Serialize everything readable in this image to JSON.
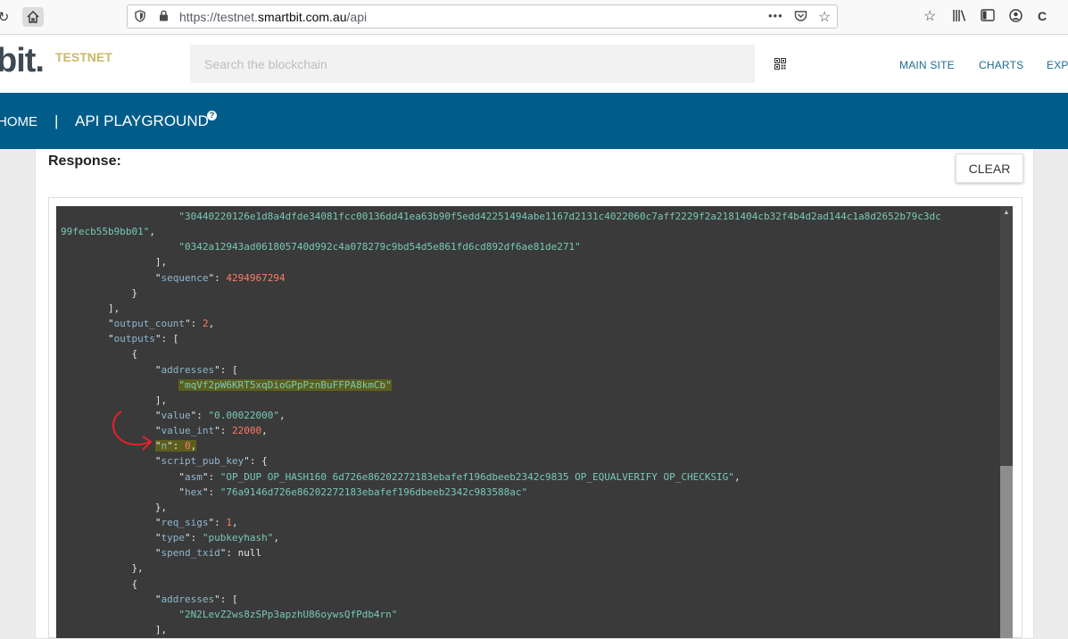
{
  "browser": {
    "url_prefix": "https://testnet.",
    "url_domain": "smartbit.com.au",
    "url_path": "/api",
    "more_glyph": "•••"
  },
  "site": {
    "logo_text": "bit.",
    "badge": "TESTNET",
    "search_placeholder": "Search the blockchain",
    "nav": [
      "MAIN SITE",
      "CHARTS",
      "EXPL"
    ]
  },
  "band": {
    "home": "HOME",
    "separator": "|",
    "page": "API PLAYGROUND",
    "help": "?"
  },
  "content": {
    "response_label": "Response:",
    "clear_button": "CLEAR"
  },
  "code_lines": [
    {
      "indent": 20,
      "parts": [
        [
          "s",
          "\"30440220126e1d8a4dfde34081fcc00136dd41ea63b90f5edd42251494abe1167d2131c4022060c7aff2229f2a2181404cb32f4b4d2ad144c1a8d2652b79c3dc"
        ]
      ]
    },
    {
      "indent": 0,
      "parts": [
        [
          "s",
          "99fecb55b9bb01\""
        ],
        [
          "p",
          ","
        ]
      ]
    },
    {
      "indent": 20,
      "parts": [
        [
          "s",
          "\"0342a12943ad061805740d992c4a078279c9bd54d5e861fd6cd892df6ae81de271\""
        ]
      ]
    },
    {
      "indent": 16,
      "parts": [
        [
          "p",
          "],"
        ]
      ]
    },
    {
      "indent": 16,
      "parts": [
        [
          "p",
          "\""
        ],
        [
          "k",
          "sequence"
        ],
        [
          "p",
          "\": "
        ],
        [
          "n",
          "4294967294"
        ]
      ]
    },
    {
      "indent": 12,
      "parts": [
        [
          "p",
          "}"
        ]
      ]
    },
    {
      "indent": 8,
      "parts": [
        [
          "p",
          "],"
        ]
      ]
    },
    {
      "indent": 8,
      "parts": [
        [
          "p",
          "\""
        ],
        [
          "k",
          "output_count"
        ],
        [
          "p",
          "\": "
        ],
        [
          "n",
          "2"
        ],
        [
          "p",
          ","
        ]
      ]
    },
    {
      "indent": 8,
      "parts": [
        [
          "p",
          "\""
        ],
        [
          "k",
          "outputs"
        ],
        [
          "p",
          "\": ["
        ]
      ]
    },
    {
      "indent": 12,
      "parts": [
        [
          "p",
          "{"
        ]
      ]
    },
    {
      "indent": 16,
      "parts": [
        [
          "p",
          "\""
        ],
        [
          "k",
          "addresses"
        ],
        [
          "p",
          "\": ["
        ]
      ]
    },
    {
      "indent": 20,
      "hl": true,
      "parts": [
        [
          "s",
          "\"mqVf2pW6KRT5xqDioGPpPznBuFFPA8kmCb\""
        ]
      ]
    },
    {
      "indent": 16,
      "parts": [
        [
          "p",
          "],"
        ]
      ]
    },
    {
      "indent": 16,
      "parts": [
        [
          "p",
          "\""
        ],
        [
          "k",
          "value"
        ],
        [
          "p",
          "\": "
        ],
        [
          "s",
          "\"0.00022000\""
        ],
        [
          "p",
          ","
        ]
      ]
    },
    {
      "indent": 16,
      "parts": [
        [
          "p",
          "\""
        ],
        [
          "k",
          "value_int"
        ],
        [
          "p",
          "\": "
        ],
        [
          "n",
          "22000"
        ],
        [
          "p",
          ","
        ]
      ]
    },
    {
      "indent": 16,
      "hl": true,
      "parts": [
        [
          "p",
          "\""
        ],
        [
          "k",
          "n"
        ],
        [
          "p",
          "\": "
        ],
        [
          "n",
          "0"
        ],
        [
          "p",
          ","
        ]
      ]
    },
    {
      "indent": 16,
      "parts": [
        [
          "p",
          "\""
        ],
        [
          "k",
          "script_pub_key"
        ],
        [
          "p",
          "\": {"
        ]
      ]
    },
    {
      "indent": 20,
      "parts": [
        [
          "p",
          "\""
        ],
        [
          "k",
          "asm"
        ],
        [
          "p",
          "\": "
        ],
        [
          "s",
          "\"OP_DUP OP_HASH160 6d726e86202272183ebafef196dbeeb2342c9835 OP_EQUALVERIFY OP_CHECKSIG\""
        ],
        [
          "p",
          ","
        ]
      ]
    },
    {
      "indent": 20,
      "parts": [
        [
          "p",
          "\""
        ],
        [
          "k",
          "hex"
        ],
        [
          "p",
          "\": "
        ],
        [
          "s",
          "\"76a9146d726e86202272183ebafef196dbeeb2342c983588ac\""
        ]
      ]
    },
    {
      "indent": 16,
      "parts": [
        [
          "p",
          "},"
        ]
      ]
    },
    {
      "indent": 16,
      "parts": [
        [
          "p",
          "\""
        ],
        [
          "k",
          "req_sigs"
        ],
        [
          "p",
          "\": "
        ],
        [
          "n",
          "1"
        ],
        [
          "p",
          ","
        ]
      ]
    },
    {
      "indent": 16,
      "parts": [
        [
          "p",
          "\""
        ],
        [
          "k",
          "type"
        ],
        [
          "p",
          "\": "
        ],
        [
          "s",
          "\"pubkeyhash\""
        ],
        [
          "p",
          ","
        ]
      ]
    },
    {
      "indent": 16,
      "parts": [
        [
          "p",
          "\""
        ],
        [
          "k",
          "spend_txid"
        ],
        [
          "p",
          "\": null"
        ]
      ]
    },
    {
      "indent": 12,
      "parts": [
        [
          "p",
          "},"
        ]
      ]
    },
    {
      "indent": 12,
      "parts": [
        [
          "p",
          "{"
        ]
      ]
    },
    {
      "indent": 16,
      "parts": [
        [
          "p",
          "\""
        ],
        [
          "k",
          "addresses"
        ],
        [
          "p",
          "\": ["
        ]
      ]
    },
    {
      "indent": 20,
      "parts": [
        [
          "s",
          "\"2N2LevZ2ws8zSPp3apzhU86oywsQfPdb4rn\""
        ]
      ]
    },
    {
      "indent": 16,
      "parts": [
        [
          "p",
          "],"
        ]
      ]
    }
  ],
  "colors": {
    "band": "#005d8a",
    "code_bg": "#3a3a3a",
    "key": "#8fb7cf",
    "string": "#77c9b8",
    "number": "#ff7a66",
    "highlight": "#5c5e1d",
    "annotation": "#e8202a"
  },
  "icons": [
    "reload-icon",
    "home-icon",
    "shield-icon",
    "lock-icon",
    "more-icon",
    "pocket-icon",
    "bookmark-star-icon",
    "bookmarks-star-icon",
    "library-icon",
    "sidebar-icon",
    "account-icon",
    "extension-icon",
    "qr-code-icon",
    "help-icon",
    "scroll-up-icon"
  ]
}
